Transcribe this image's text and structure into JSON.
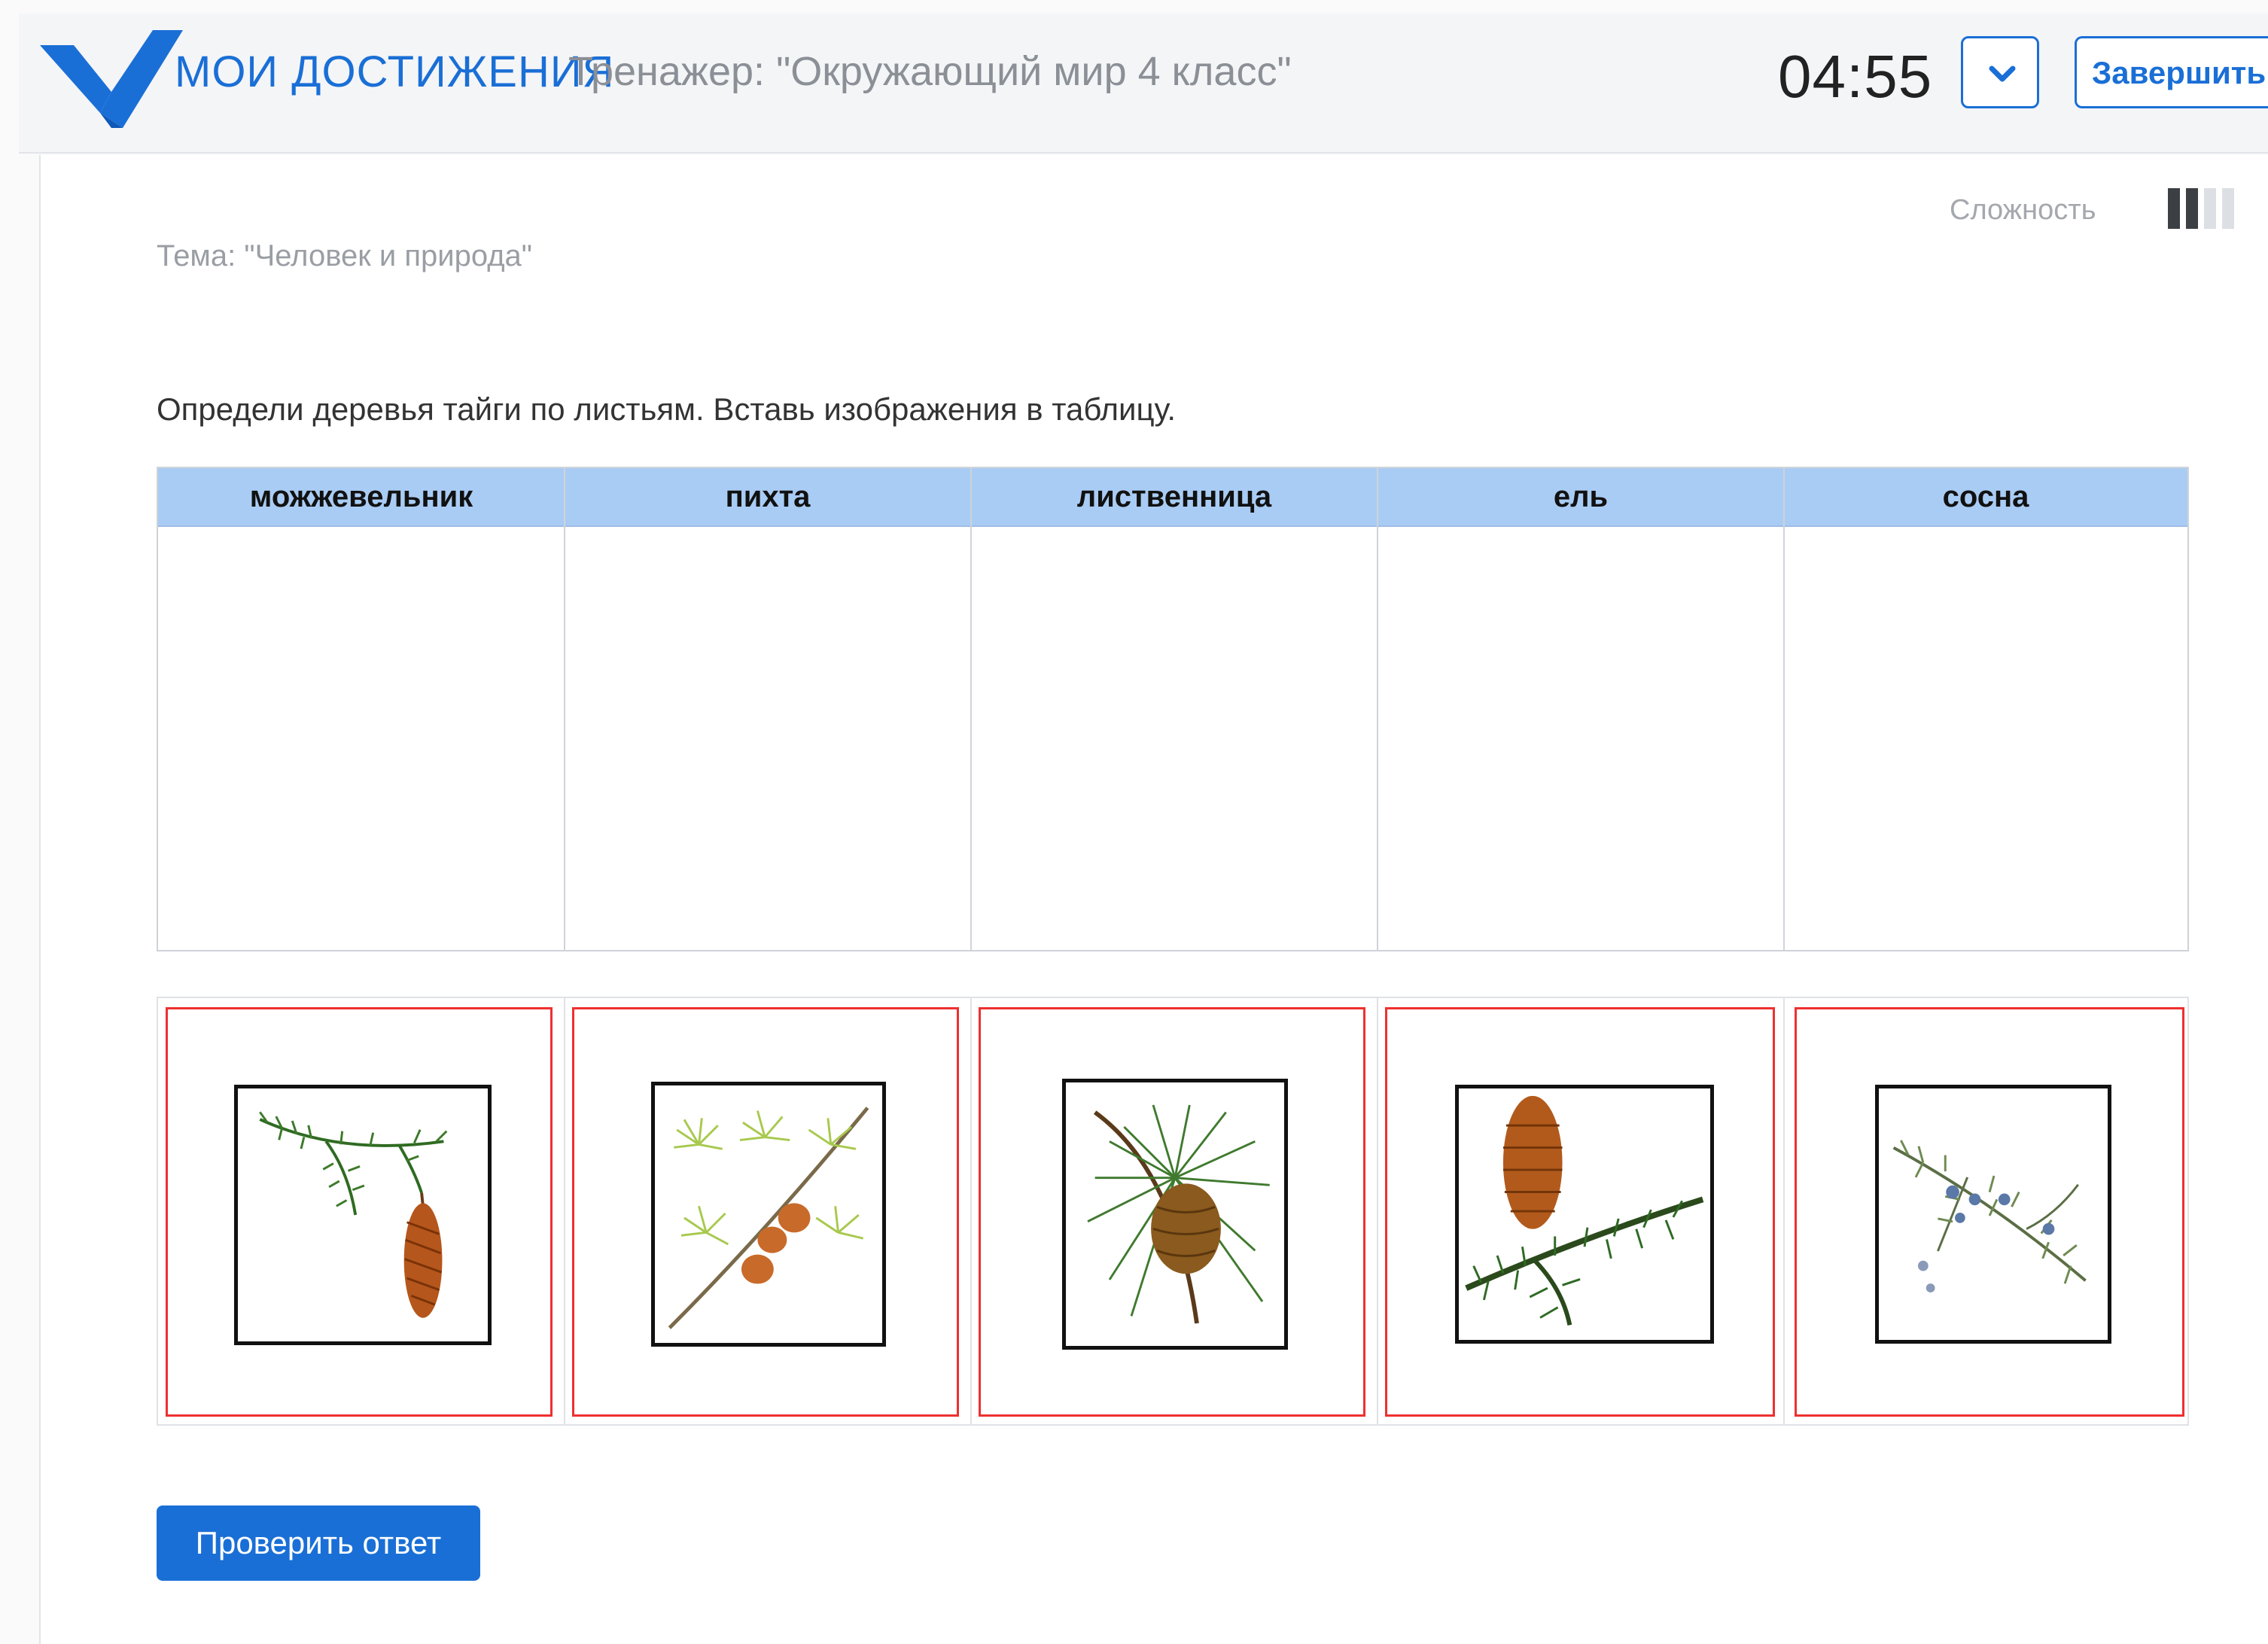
{
  "header": {
    "brand": "МОИ ДОСТИЖЕНИЯ",
    "trainer_title": "Тренажер: \"Окружающий мир 4 класс\"",
    "timer": "04:55",
    "finish_label": "Завершить"
  },
  "task": {
    "difficulty_label": "Сложность",
    "difficulty_level": 2,
    "difficulty_max": 4,
    "topic": "Тема: \"Человек и природа\"",
    "instruction": "Определи деревья тайги по листьям. Вставь изображения в таблицу."
  },
  "table": {
    "columns": [
      "можжевельник",
      "пихта",
      "лиственница",
      "ель",
      "сосна"
    ]
  },
  "bank": {
    "images": [
      {
        "icon": "spruce-branch-cone-icon"
      },
      {
        "icon": "larch-branch-icon"
      },
      {
        "icon": "pine-branch-cone-icon"
      },
      {
        "icon": "fir-branch-cone-icon"
      },
      {
        "icon": "juniper-branch-icon"
      }
    ]
  },
  "actions": {
    "check_label": "Проверить ответ"
  },
  "colors": {
    "accent": "#1a6fd6",
    "table_header": "#a9ccf4",
    "slot_border": "#ee3030"
  }
}
